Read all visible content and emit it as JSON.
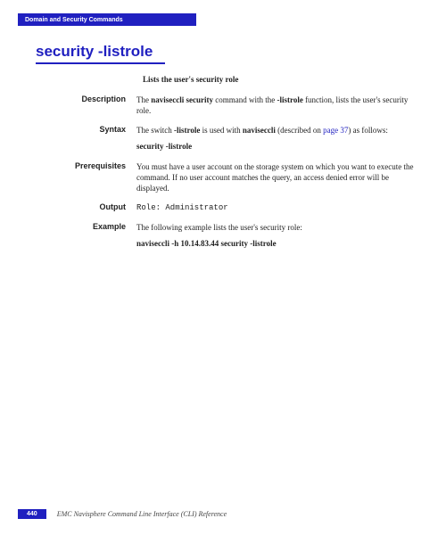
{
  "header": {
    "section": "Domain and Security Commands"
  },
  "title": "security -listrole",
  "summary": "Lists the user's security role",
  "sections": {
    "description": {
      "label": "Description",
      "text_pre": "The ",
      "bold1": "naviseccli security",
      "text_mid": " command with the ",
      "bold2": "-listrole",
      "text_post": " function, lists the user's security role."
    },
    "syntax": {
      "label": "Syntax",
      "text_pre": "The switch ",
      "bold1": "-listrole",
      "text_mid": " is used with ",
      "bold2": "naviseccli",
      "text_paren_pre": " (described on ",
      "link": "page 37",
      "text_paren_post": ") as follows:",
      "command": "security -listrole"
    },
    "prerequisites": {
      "label": "Prerequisites",
      "text": "You must have a user account on the storage system on which you want to execute the command. If no user account matches the query, an access denied error will be displayed."
    },
    "output": {
      "label": "Output",
      "text": "Role:  Administrator"
    },
    "example": {
      "label": "Example",
      "text": "The following example lists the user's security role:",
      "command": "naviseccli -h 10.14.83.44 security -listrole"
    }
  },
  "footer": {
    "page": "440",
    "doc": "EMC Navisphere Command Line Interface (CLI) Reference"
  }
}
